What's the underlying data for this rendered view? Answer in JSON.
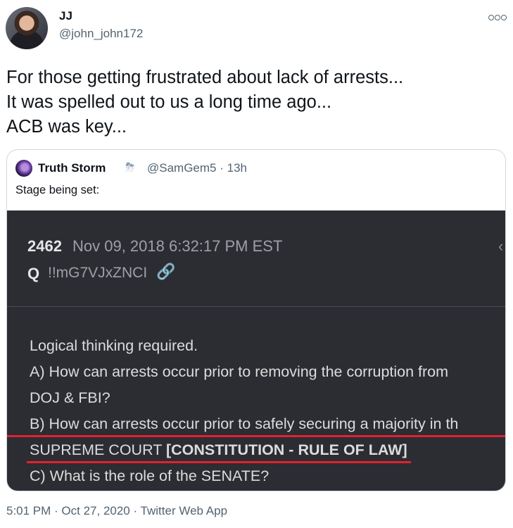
{
  "tweet": {
    "author_name": "JJ",
    "author_handle": "@john_john172",
    "more_glyph": "",
    "text_lines": [
      "For those getting frustrated about lack of arrests...",
      "It was spelled out to us a long time ago...",
      "ACB was key..."
    ],
    "timestamp": "5:01 PM · Oct 27, 2020 · Twitter Web App"
  },
  "quote": {
    "author_name": "Truth Storm",
    "emoji": "⛈",
    "handle_time": "@SamGem5 · 13h",
    "text": "Stage being set:",
    "image": {
      "post_number": "2462",
      "post_date": "Nov 09, 2018 6:32:17 PM EST",
      "q_label": "Q",
      "tripcode": "!!mG7VJxZNCI",
      "body_lines": {
        "l1": "Logical thinking required.",
        "l2": "A)   How can arrests occur prior to removing the corruption from",
        "l3": "DOJ & FBI?",
        "l4": "B)   How can arrests occur prior to safely securing a majority in th",
        "l5a": "SUPREME COURT ",
        "l5b": "[CONSTITUTION - RULE OF LAW]",
        "l6": "C)   What is the role of the SENATE?"
      }
    }
  },
  "colors": {
    "underline": "#e3212d",
    "image_bg": "#2b2d33",
    "link": "#3b82f6"
  }
}
